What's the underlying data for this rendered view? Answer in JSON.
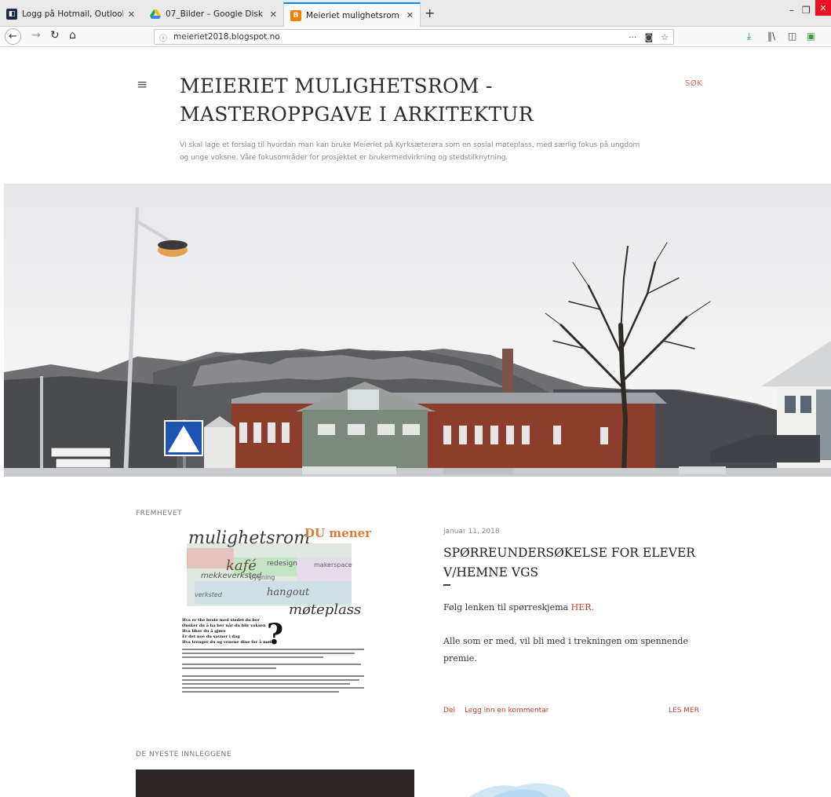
{
  "browser": {
    "tabs": [
      {
        "title": "Logg på Hotmail, Outlook, Ma",
        "active": false
      },
      {
        "title": "07_Bilder – Google Disk",
        "active": false
      },
      {
        "title": "Meieriet mulighetsrom - Maste",
        "active": true
      }
    ],
    "url": "meieriet2018.blogspot.no",
    "new_tab_glyph": "+",
    "close_glyph": "✕"
  },
  "header": {
    "title_line1": "MEIERIET MULIGHETSROM -",
    "title_line2": "MASTEROPPGAVE I ARKITEKTUR",
    "search_label": "SØK",
    "description": "Vi skal lage et forslag til hvordan man kan bruke Meieriet på Kyrksæterøra som en sosial møteplass, med særlig fokus på ungdom og unge voksne. Våre fokusområder for prosjektet er brukermedvirkning og stedstilknytning."
  },
  "featured": {
    "section_label": "FREMHEVET",
    "poster": {
      "heading_left": "mulighetsrom",
      "heading_right": "DU mener",
      "words": [
        "kafé",
        "redesign",
        "makerspace",
        "mekkeverksted",
        "bygning",
        "hangout",
        "møteplass",
        "verksted"
      ],
      "lines": [
        "Hva er the beste med stedet du bor",
        "Ønsker du å ha her når du blir voksen",
        "Hva liker du å gjøre",
        "Er det noe du savner i dag",
        "Hva trenger du og venene dine for å møtes"
      ],
      "question_mark": "?"
    },
    "date": "januar 11, 2018",
    "title_line1": "SPØRREUNDERSØKELSE FOR ELEVER",
    "title_line2": "V/HEMNE VGS",
    "body1_prefix": "Følg lenken til spørreskjema ",
    "body1_link": "HER.",
    "body2": "Alle som er med, vil bli med i trekningen om spennende premie.",
    "share_label": "Del",
    "comment_label": "Legg inn en kommentar",
    "read_more_label": "LES MER"
  },
  "recent": {
    "section_label": "DE NYESTE INNLEGGENE"
  },
  "colors": {
    "accent": "#c54032",
    "search": "#e0675b",
    "tab_active_border": "#0a84ff"
  }
}
